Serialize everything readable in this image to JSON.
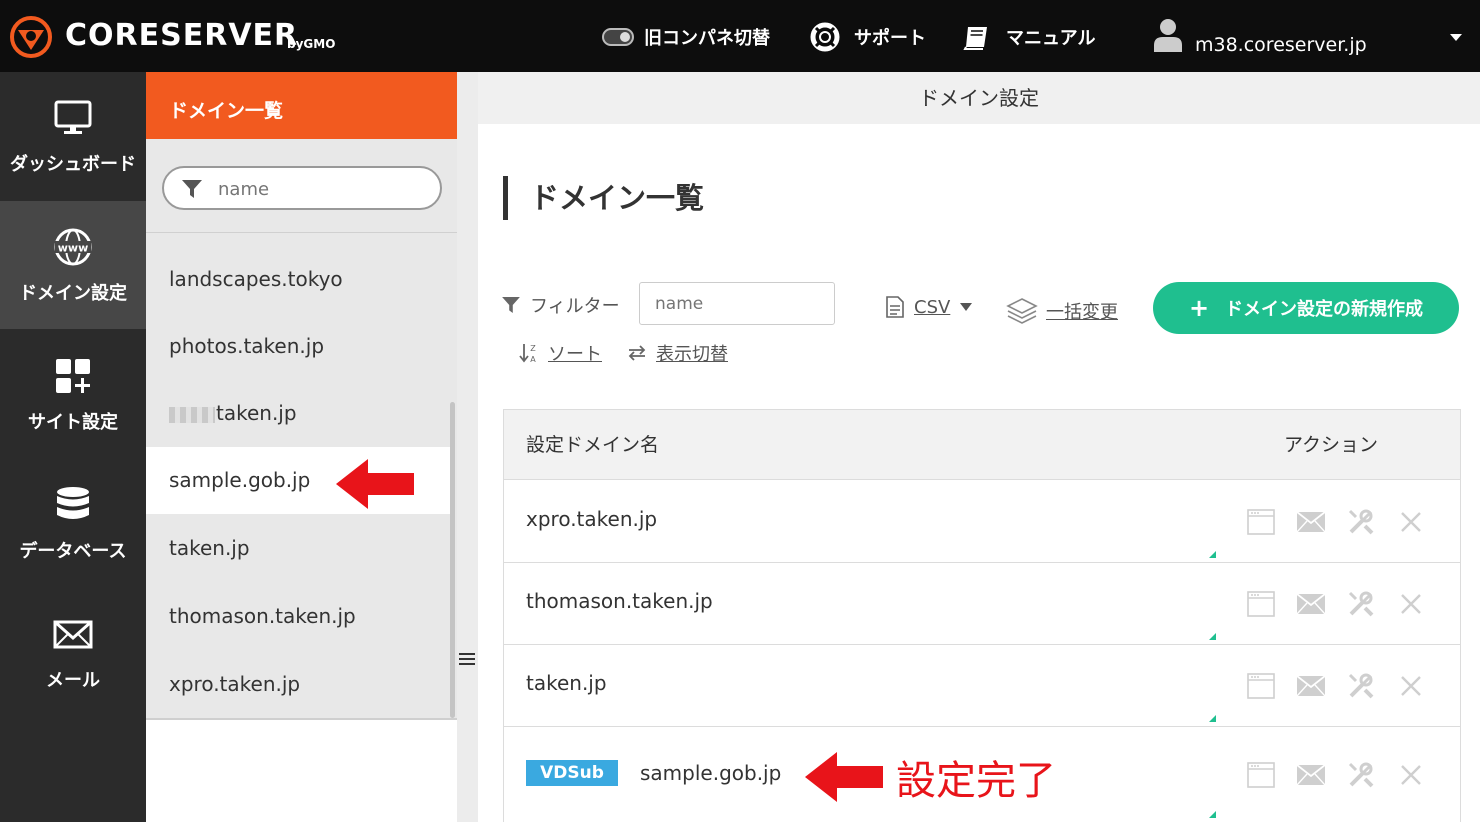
{
  "brand": {
    "name": "CORESERVER",
    "by": "byGMO",
    "accent": "#f25a1f"
  },
  "topnav": {
    "legacy_panel": "旧コンパネ切替",
    "support": "サポート",
    "manual": "マニュアル",
    "user_host": "m38.coreserver.jp"
  },
  "sidebar": {
    "items": [
      {
        "label": "ダッシュボード",
        "icon": "monitor-icon"
      },
      {
        "label": "ドメイン設定",
        "icon": "globe-www-icon"
      },
      {
        "label": "サイト設定",
        "icon": "grid-plus-icon"
      },
      {
        "label": "データベース",
        "icon": "database-icon"
      },
      {
        "label": "メール",
        "icon": "envelope-icon"
      }
    ]
  },
  "domain_panel": {
    "title": "ドメイン一覧",
    "search_placeholder": "name",
    "items": [
      {
        "label": "landscapes.tokyo"
      },
      {
        "label": "photos.taken.jp"
      },
      {
        "label": "taken.jp",
        "masked_prefix": true
      },
      {
        "label": "sample.gob.jp",
        "selected": true
      },
      {
        "label": "taken.jp"
      },
      {
        "label": "thomason.taken.jp"
      },
      {
        "label": "xpro.taken.jp"
      }
    ]
  },
  "main": {
    "header": "ドメイン設定",
    "page_title": "ドメイン一覧",
    "toolbar": {
      "filter_label": "フィルター",
      "filter_placeholder": "name",
      "csv_label": "CSV",
      "bulk_label": "一括変更",
      "new_button": "ドメイン設定の新規作成",
      "sort_label": "ソート",
      "view_toggle_label": "表示切替"
    },
    "table": {
      "col_name": "設定ドメイン名",
      "col_action": "アクション",
      "rows": [
        {
          "name": "xpro.taken.jp"
        },
        {
          "name": "thomason.taken.jp"
        },
        {
          "name": "taken.jp"
        },
        {
          "name": "sample.gob.jp",
          "badge": "VDSub"
        }
      ]
    }
  },
  "annotation": {
    "text": "設定完了",
    "color": "#e8141a"
  }
}
